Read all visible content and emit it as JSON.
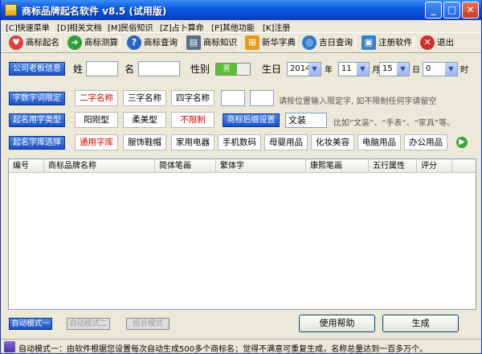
{
  "window": {
    "title": "商标品牌起名软件 v8.5 (试用版)",
    "buttons": {
      "minimize": "_",
      "maximize": "□",
      "close": "✕"
    }
  },
  "menu": [
    {
      "label": "[C]快速菜单"
    },
    {
      "label": "[D]相关文档"
    },
    {
      "label": "[M]民俗知识"
    },
    {
      "label": "[Z]占卜算命"
    },
    {
      "label": "[P]其他功能"
    },
    {
      "label": "[K]注册"
    }
  ],
  "toolbar": [
    {
      "label": "商标起名",
      "icon": "heart-icon",
      "color": "#e0403a",
      "glyph": "♥"
    },
    {
      "label": "商标测算",
      "icon": "arrow-right-icon",
      "color": "#2e9f3a",
      "glyph": "➜"
    },
    {
      "label": "商标查询",
      "icon": "help-icon",
      "color": "#2a62c8",
      "glyph": "?"
    },
    {
      "label": "商标知识",
      "icon": "document-icon",
      "color": "#5b6f8c",
      "glyph": "▤"
    },
    {
      "label": "新华字典",
      "icon": "windows-icon",
      "color": "#e89a1c",
      "glyph": "⊞"
    },
    {
      "label": "吉日查询",
      "icon": "globe-icon",
      "color": "#2a7ad0",
      "glyph": "◎"
    },
    {
      "label": "注册软件",
      "icon": "computer-icon",
      "color": "#3a82c8",
      "glyph": "▣"
    },
    {
      "label": "退出",
      "icon": "close-icon",
      "color": "#d0302a",
      "glyph": "✕"
    }
  ],
  "owner": {
    "section_label": "公司老板信息",
    "surname_label": "姓",
    "surname_value": "",
    "name_label": "名",
    "name_value": "",
    "gender_label": "性别",
    "gender_value": "男",
    "birthday_label": "生日",
    "year": "2014",
    "year_unit": "年",
    "month": "11",
    "month_unit": "月",
    "day": "15",
    "day_unit": "日",
    "hour": "0",
    "hour_unit": "时"
  },
  "word_limit": {
    "section_label": "字数字词限定",
    "options": [
      "二字名称",
      "三字名称",
      "四字名称"
    ],
    "fixed1": "",
    "fixed2": "",
    "hint": "请按位置输入限定字, 如不限制任何字请留空"
  },
  "style": {
    "section_label": "起名用字类型",
    "options": [
      "阳刚型",
      "柔美型",
      "不限制"
    ],
    "suffix_button": "商标后缀设置",
    "suffix_value": "文装",
    "hint": "比如“文装”、“手表”、“家具”等。"
  },
  "library": {
    "section_label": "起名字库选择",
    "options": [
      "通用字库",
      "服饰鞋帽",
      "家用电器",
      "手机数码",
      "母婴用品",
      "化妆美容",
      "电脑用品",
      "办公用品"
    ],
    "next_icon": "arrow-right-icon"
  },
  "table": {
    "columns": [
      "编号",
      "商标品牌名称",
      "简体笔画",
      "繁体字",
      "康熙笔画",
      "五行属性",
      "评分"
    ],
    "rows": []
  },
  "modes": [
    "自动模式一",
    "自动模式二",
    "组合模式"
  ],
  "actions": {
    "help": "使用帮助",
    "generate": "生成"
  },
  "status": "自动模式一：由软件根据您设置每次自动生成500多个商标名；觉得不满意可重复生成，名称总量达到一百多万个。"
}
